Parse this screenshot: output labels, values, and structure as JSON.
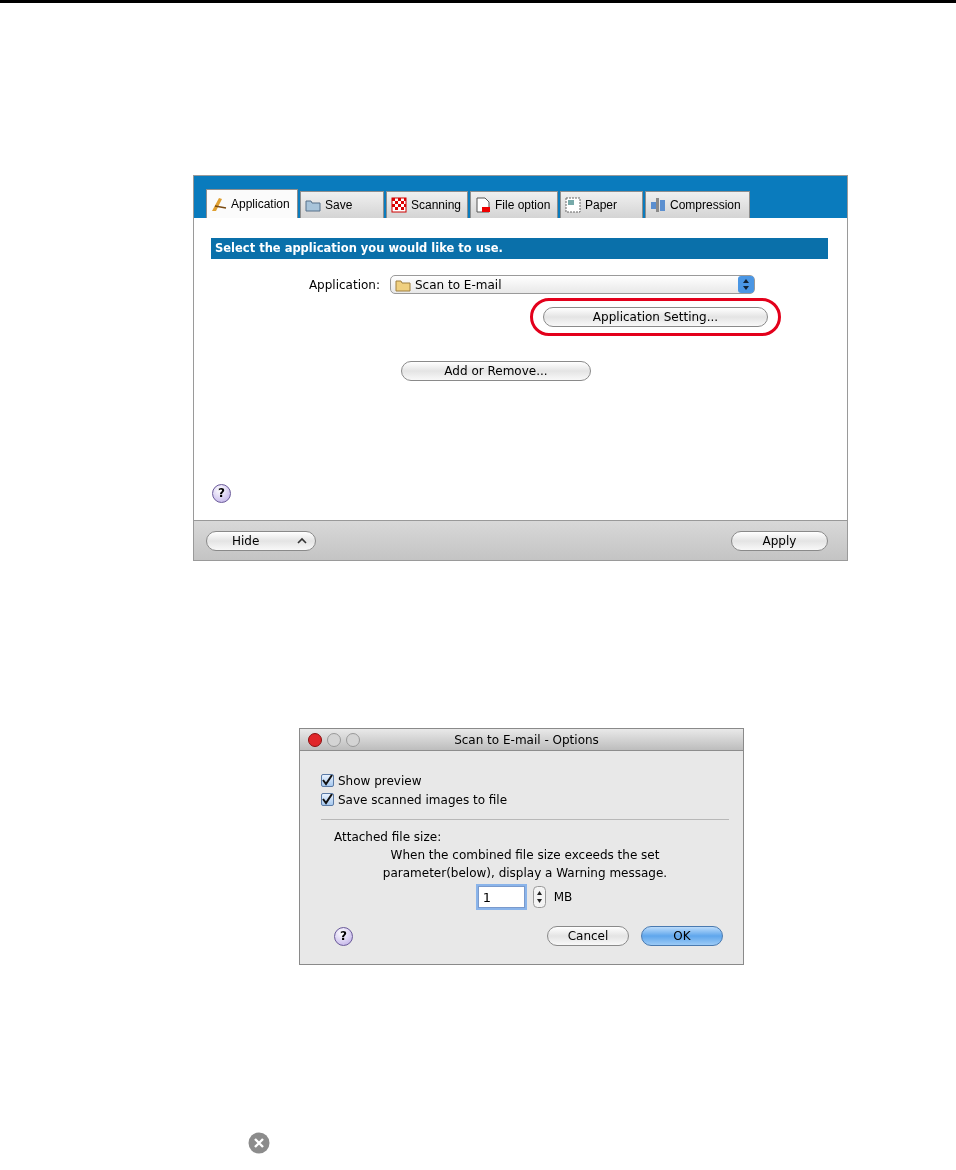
{
  "panel": {
    "tabs": [
      {
        "label": "Application",
        "selected": true
      },
      {
        "label": "Save",
        "selected": false
      },
      {
        "label": "Scanning",
        "selected": false
      },
      {
        "label": "File option",
        "selected": false
      },
      {
        "label": "Paper",
        "selected": false
      },
      {
        "label": "Compression",
        "selected": false
      }
    ],
    "heading": "Select the application you would like to use.",
    "application_label": "Application:",
    "application_value": "Scan to E-mail",
    "setting_button": "Application Setting...",
    "add_remove_button": "Add or Remove...",
    "help": "?",
    "hide_button": "Hide",
    "apply_button": "Apply"
  },
  "dialog": {
    "title": "Scan to E-mail - Options",
    "checkboxes": [
      {
        "label": "Show preview",
        "checked": true
      },
      {
        "label": "Save scanned images to file",
        "checked": true
      }
    ],
    "section_label": "Attached file size:",
    "description": "When the combined file size exceeds the set parameter(below), display a Warning message.",
    "size_value": "1",
    "unit": "MB",
    "help": "?",
    "cancel_button": "Cancel",
    "ok_button": "OK"
  }
}
